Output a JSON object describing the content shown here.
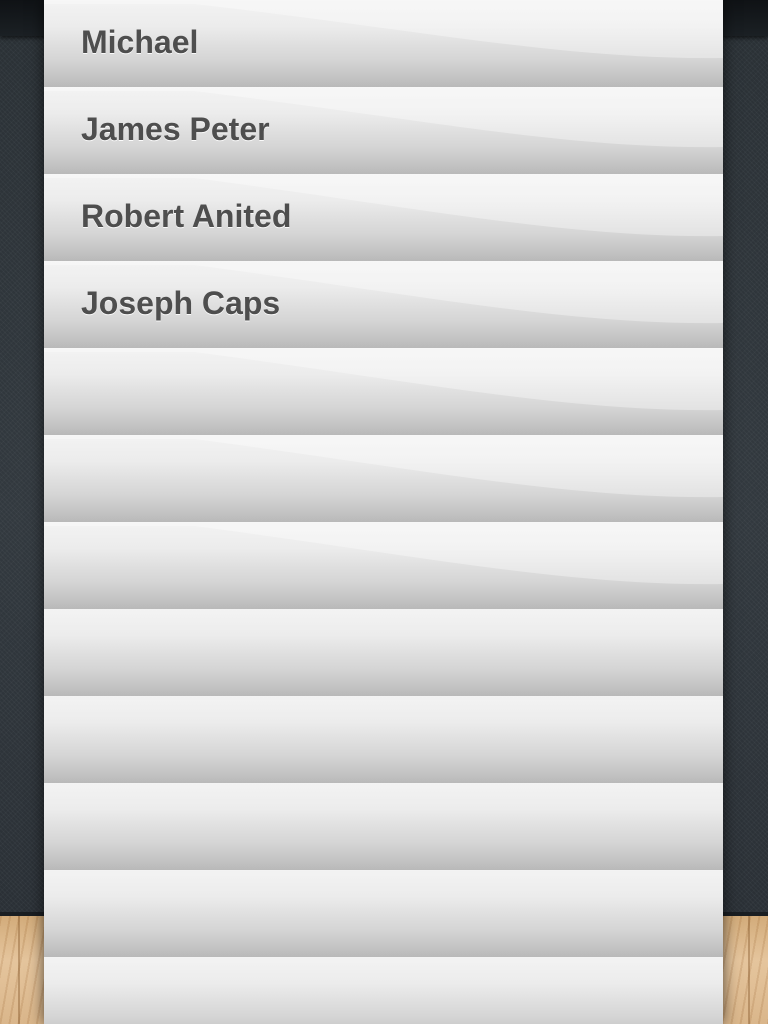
{
  "list": {
    "items": [
      {
        "label": "Michael"
      },
      {
        "label": "James Peter"
      },
      {
        "label": "Robert Anited"
      },
      {
        "label": "Joseph Caps"
      },
      {
        "label": ""
      },
      {
        "label": ""
      },
      {
        "label": ""
      },
      {
        "label": ""
      },
      {
        "label": ""
      },
      {
        "label": ""
      },
      {
        "label": ""
      },
      {
        "label": ""
      }
    ]
  },
  "colors": {
    "row_top": "#f3f3f3",
    "row_bottom": "#b9b9b9",
    "label_text": "#4e4e4e",
    "backdrop": "#2c3338",
    "floor": "#d9b68a"
  }
}
